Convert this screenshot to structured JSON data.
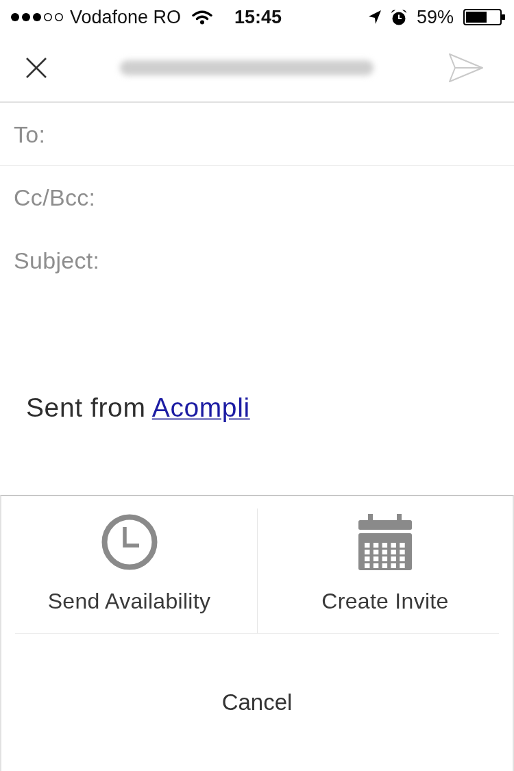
{
  "status_bar": {
    "carrier": "Vodafone RO",
    "time": "15:45",
    "battery": "59%"
  },
  "header": {
    "address": {
      "blurred": true
    },
    "send_button": {
      "disabled": true
    }
  },
  "compose": {
    "fields": [
      {
        "label": "To:"
      },
      {
        "label": "Cc/Bcc:"
      },
      {
        "label": "Subject:"
      }
    ],
    "signature": {
      "text": "Sent from",
      "link": "Acompli"
    }
  },
  "action_sheet": {
    "options": [
      {
        "label": "Send Availability"
      },
      {
        "label": "Create Invite"
      }
    ],
    "cancel": "Cancel"
  }
}
